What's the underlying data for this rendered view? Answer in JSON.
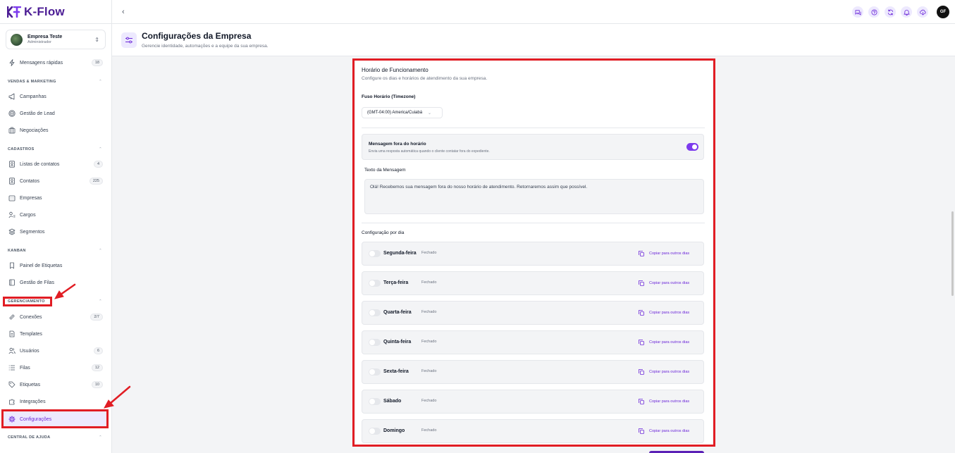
{
  "app": {
    "name": "K-Flow"
  },
  "colors": {
    "accent": "#6d28d9",
    "brand": "#4c1d95",
    "highlight": "#e11d24"
  },
  "company": {
    "name": "Empresa Teste",
    "role": "Administrador"
  },
  "sidebar": {
    "quick_messages": {
      "label": "Mensagens rápidas",
      "badge": "18",
      "icon": "lightning-icon"
    },
    "sections": [
      {
        "title": "VENDAS & MARKETING",
        "items": [
          {
            "label": "Campanhas",
            "icon": "megaphone-icon"
          },
          {
            "label": "Gestão de Lead",
            "icon": "target-icon"
          },
          {
            "label": "Negociações",
            "icon": "briefcase-icon"
          }
        ]
      },
      {
        "title": "CADASTROS",
        "items": [
          {
            "label": "Listas de contatos",
            "badge": "4",
            "icon": "address-book-icon"
          },
          {
            "label": "Contatos",
            "badge": "225",
            "icon": "contact-card-icon"
          },
          {
            "label": "Empresas",
            "icon": "building-icon"
          },
          {
            "label": "Cargos",
            "icon": "user-role-icon"
          },
          {
            "label": "Segmentos",
            "icon": "layers-icon"
          }
        ]
      },
      {
        "title": "KANBAN",
        "items": [
          {
            "label": "Painel de Etiquetas",
            "icon": "bookmark-icon"
          },
          {
            "label": "Gestão de Filas",
            "icon": "book-icon"
          }
        ]
      },
      {
        "title": "GERENCIAMENTO",
        "items": [
          {
            "label": "Conexões",
            "badge": "2/7",
            "icon": "link-icon"
          },
          {
            "label": "Templates",
            "icon": "document-icon"
          },
          {
            "label": "Usuários",
            "badge": "6",
            "icon": "users-icon"
          },
          {
            "label": "Filas",
            "badge": "12",
            "icon": "list-icon"
          },
          {
            "label": "Etiquetas",
            "badge": "10",
            "icon": "tag-icon"
          },
          {
            "label": "Integrações",
            "icon": "puzzle-icon"
          },
          {
            "label": "Configurações",
            "icon": "gear-icon",
            "active": true
          }
        ]
      },
      {
        "title": "CENTRAL DE AJUDA",
        "items": []
      }
    ]
  },
  "topbar": {
    "user_initials": "GF"
  },
  "page": {
    "title": "Configurações da Empresa",
    "subtitle": "Gerencie identidade, automações e a equipe da sua empresa."
  },
  "hours": {
    "title": "Horário de Funcionamento",
    "subtitle": "Configure os dias e horários de atendimento da sua empresa.",
    "timezone_label": "Fuso Horário (Timezone)",
    "timezone_value": "(GMT-04:00) America/Cuiabá",
    "after_hours": {
      "title": "Mensagem fora do horário",
      "description": "Envia uma resposta automática quando o cliente contatar fora do expediente.",
      "enabled": true
    },
    "message_label": "Texto da Mensagem",
    "message_text": "Olá! Recebemos sua mensagem fora do nosso horário de atendimento. Retornaremos assim que possível.",
    "per_day_label": "Configuração por dia",
    "copy_label": "Copiar para outros dias",
    "days": [
      {
        "name": "Segunda-feira",
        "status": "Fechado",
        "enabled": false
      },
      {
        "name": "Terça-feira",
        "status": "Fechado",
        "enabled": false
      },
      {
        "name": "Quarta-feira",
        "status": "Fechado",
        "enabled": false
      },
      {
        "name": "Quinta-feira",
        "status": "Fechado",
        "enabled": false
      },
      {
        "name": "Sexta-feira",
        "status": "Fechado",
        "enabled": false
      },
      {
        "name": "Sábado",
        "status": "Fechado",
        "enabled": false
      },
      {
        "name": "Domingo",
        "status": "Fechado",
        "enabled": false
      }
    ]
  }
}
